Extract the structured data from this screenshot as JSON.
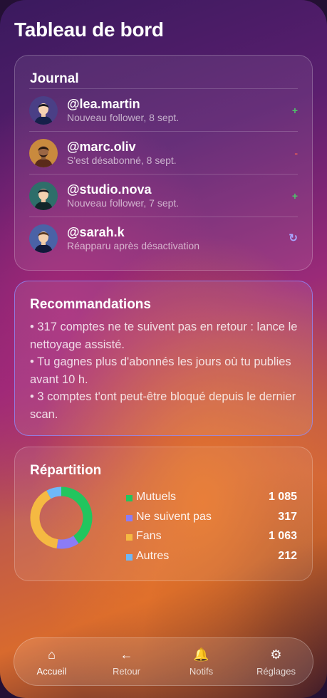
{
  "header": {
    "title": "Tableau de bord"
  },
  "journal": {
    "title": "Journal",
    "items": [
      {
        "handle": "@lea.martin",
        "detail": "Nouveau follower, 8 sept.",
        "mark": "+",
        "type": "plus"
      },
      {
        "handle": "@marc.oliv",
        "detail": "S'est désabonné, 8 sept.",
        "mark": "-",
        "type": "minus"
      },
      {
        "handle": "@studio.nova",
        "detail": "Nouveau follower, 7 sept.",
        "mark": "+",
        "type": "plus"
      },
      {
        "handle": "@sarah.k",
        "detail": "Réapparu après désactivation",
        "mark": "↻",
        "type": "redo"
      }
    ]
  },
  "recommendations": {
    "title": "Recommandations",
    "items": [
      "• 317 comptes ne te suivent pas en retour : lance le nettoyage assisté.",
      "• Tu gagnes plus d'abonnés les jours où tu publies avant 10 h.",
      "• 3 comptes t'ont peut-être bloqué depuis le dernier scan."
    ]
  },
  "repartition": {
    "title": "Répartition",
    "legend": [
      {
        "label": "Mutuels",
        "value": "1 085",
        "color": "#22c55e"
      },
      {
        "label": "Ne suivent pas",
        "value": "317",
        "color": "#8b7cf6"
      },
      {
        "label": "Fans",
        "value": "1 063",
        "color": "#f5b942"
      },
      {
        "label": "Autres",
        "value": "212",
        "color": "#6eb8f7"
      }
    ]
  },
  "chart_data": {
    "type": "pie",
    "categories": [
      "Mutuels",
      "Ne suivent pas",
      "Fans",
      "Autres"
    ],
    "values": [
      1085,
      317,
      1063,
      212
    ],
    "colors": [
      "#22c55e",
      "#8b7cf6",
      "#f5b942",
      "#6eb8f7"
    ],
    "title": "Répartition",
    "donut": true
  },
  "nav": {
    "items": [
      {
        "icon": "home-icon",
        "glyph": "⌂",
        "label": "Accueil",
        "active": true
      },
      {
        "icon": "back-arrow-icon",
        "glyph": "←",
        "label": "Retour",
        "active": false
      },
      {
        "icon": "bell-icon",
        "glyph": "🔔",
        "label": "Notifs",
        "active": false
      },
      {
        "icon": "gear-icon",
        "glyph": "⚙",
        "label": "Réglages",
        "active": false
      }
    ]
  }
}
